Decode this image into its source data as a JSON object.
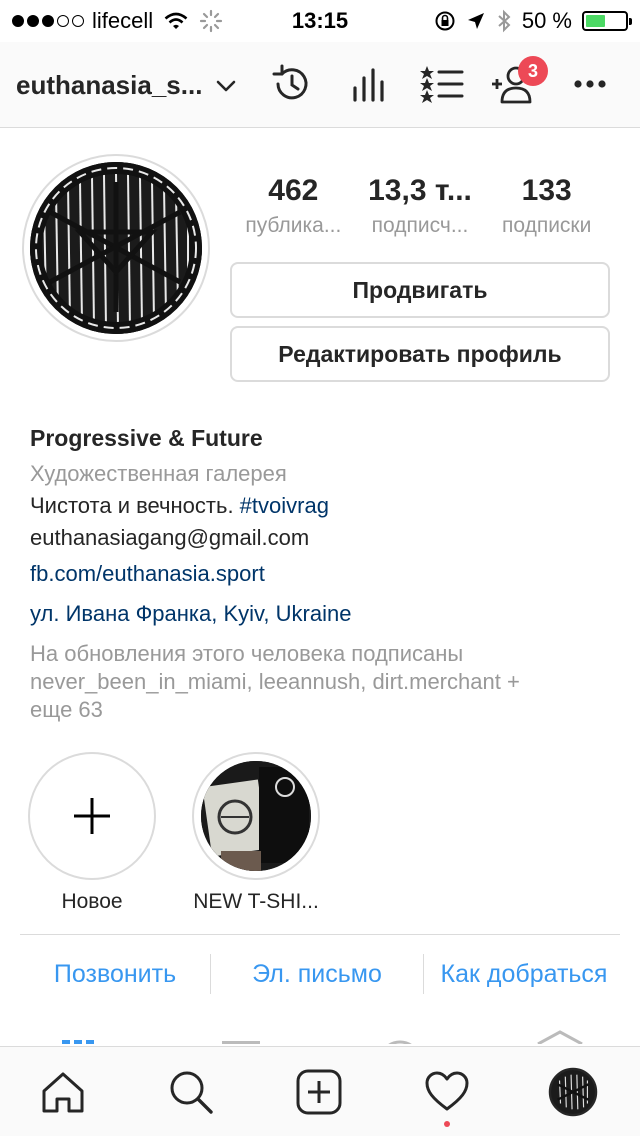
{
  "status_bar": {
    "carrier": "lifecell",
    "time": "13:15",
    "battery_percent": "50 %",
    "battery_level": 0.5,
    "signal_full": 3,
    "signal_total": 5
  },
  "header": {
    "username": "euthanasia_s...",
    "notification_count": "3"
  },
  "stats": {
    "posts_count": "462",
    "posts_label": "публика...",
    "followers_count": "13,3 т...",
    "followers_label": "подписч...",
    "following_count": "133",
    "following_label": "подписки"
  },
  "buttons": {
    "promote": "Продвигать",
    "edit_profile": "Редактировать профиль"
  },
  "bio": {
    "name": "Progressive & Future",
    "category": "Художественная галерея",
    "text": "Чистота и вечность. ",
    "hashtag": "#tvoivrag",
    "email": "euthanasiagang@gmail.com",
    "website": "fb.com/euthanasia.sport",
    "address": "ул. Ивана Франка, Kyiv, Ukraine",
    "followed_by_line1": "На обновления этого человека подписаны",
    "followed_by_line2": "never_been_in_miami, leeannush, dirt.merchant +",
    "followed_by_line3": "еще 63"
  },
  "highlights": [
    {
      "label": "Новое"
    },
    {
      "label": "NEW T-SHI..."
    }
  ],
  "contact": {
    "call": "Позвонить",
    "email": "Эл. письмо",
    "directions": "Как добраться"
  },
  "colors": {
    "link_dark": "#003569",
    "link_blue": "#3897f0",
    "badge_red": "#ed4956",
    "battery_green": "#4cd964",
    "muted_gray": "#999999",
    "border_gray": "#dbdbdb"
  }
}
